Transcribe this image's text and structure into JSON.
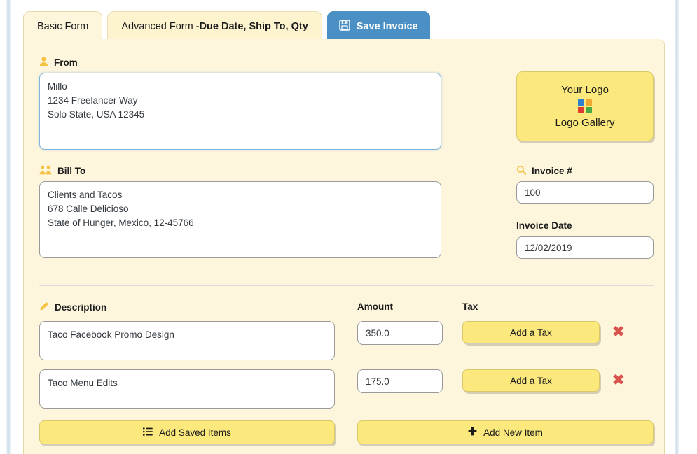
{
  "tabs": [
    {
      "label": "Basic Form",
      "active": true,
      "name": "tab-basic-form"
    },
    {
      "label_prefix": "Advanced Form - ",
      "label_bold": "Due Date, Ship To, Qty",
      "active": false,
      "name": "tab-advanced-form"
    }
  ],
  "save_tab": {
    "label": "Save Invoice",
    "icon": "floppy-disk-icon",
    "color": "#4a90c4"
  },
  "from": {
    "label": "From",
    "icon": "person-icon",
    "value": "Millo\n1234 Freelancer Way\nSolo State, USA 12345",
    "focused": true
  },
  "bill_to": {
    "label": "Bill To",
    "icon": "people-group-icon",
    "value": "Clients and Tacos\n678 Calle Delicioso\nState of Hunger, Mexico, 12-45766"
  },
  "logo": {
    "title": "Your Logo",
    "gallery_label": "Logo Gallery",
    "icon": "color-grid-icon",
    "swatches": [
      "#2f7fd1",
      "#f0a830",
      "#e03b2f",
      "#4aa845"
    ]
  },
  "invoice_number": {
    "label": "Invoice #",
    "icon": "search-icon",
    "value": "100"
  },
  "invoice_date": {
    "label": "Invoice Date",
    "value": "12/02/2019"
  },
  "columns": {
    "description": {
      "label": "Description",
      "icon": "pencil-icon"
    },
    "amount": {
      "label": "Amount"
    },
    "tax": {
      "label": "Tax"
    }
  },
  "line_items": [
    {
      "description": "Taco Facebook Promo Design",
      "amount": "350.0",
      "tax_button": "Add a Tax",
      "delete_icon": "remove-x-icon"
    },
    {
      "description": "Taco Menu Edits",
      "amount": "175.0",
      "tax_button": "Add a Tax",
      "delete_icon": "remove-x-icon"
    }
  ],
  "footer_buttons": {
    "add_saved_items": {
      "label": "Add Saved Items",
      "icon": "list-icon"
    },
    "add_new_item": {
      "label": "Add New Item",
      "icon": "plus-icon"
    }
  },
  "theme": {
    "panel_bg": "#fdf6dd",
    "button_yellow": "#fce97d",
    "accent_blue": "#4a90c4",
    "icon_gold": "#f5c243",
    "danger_red": "#d9534f"
  }
}
